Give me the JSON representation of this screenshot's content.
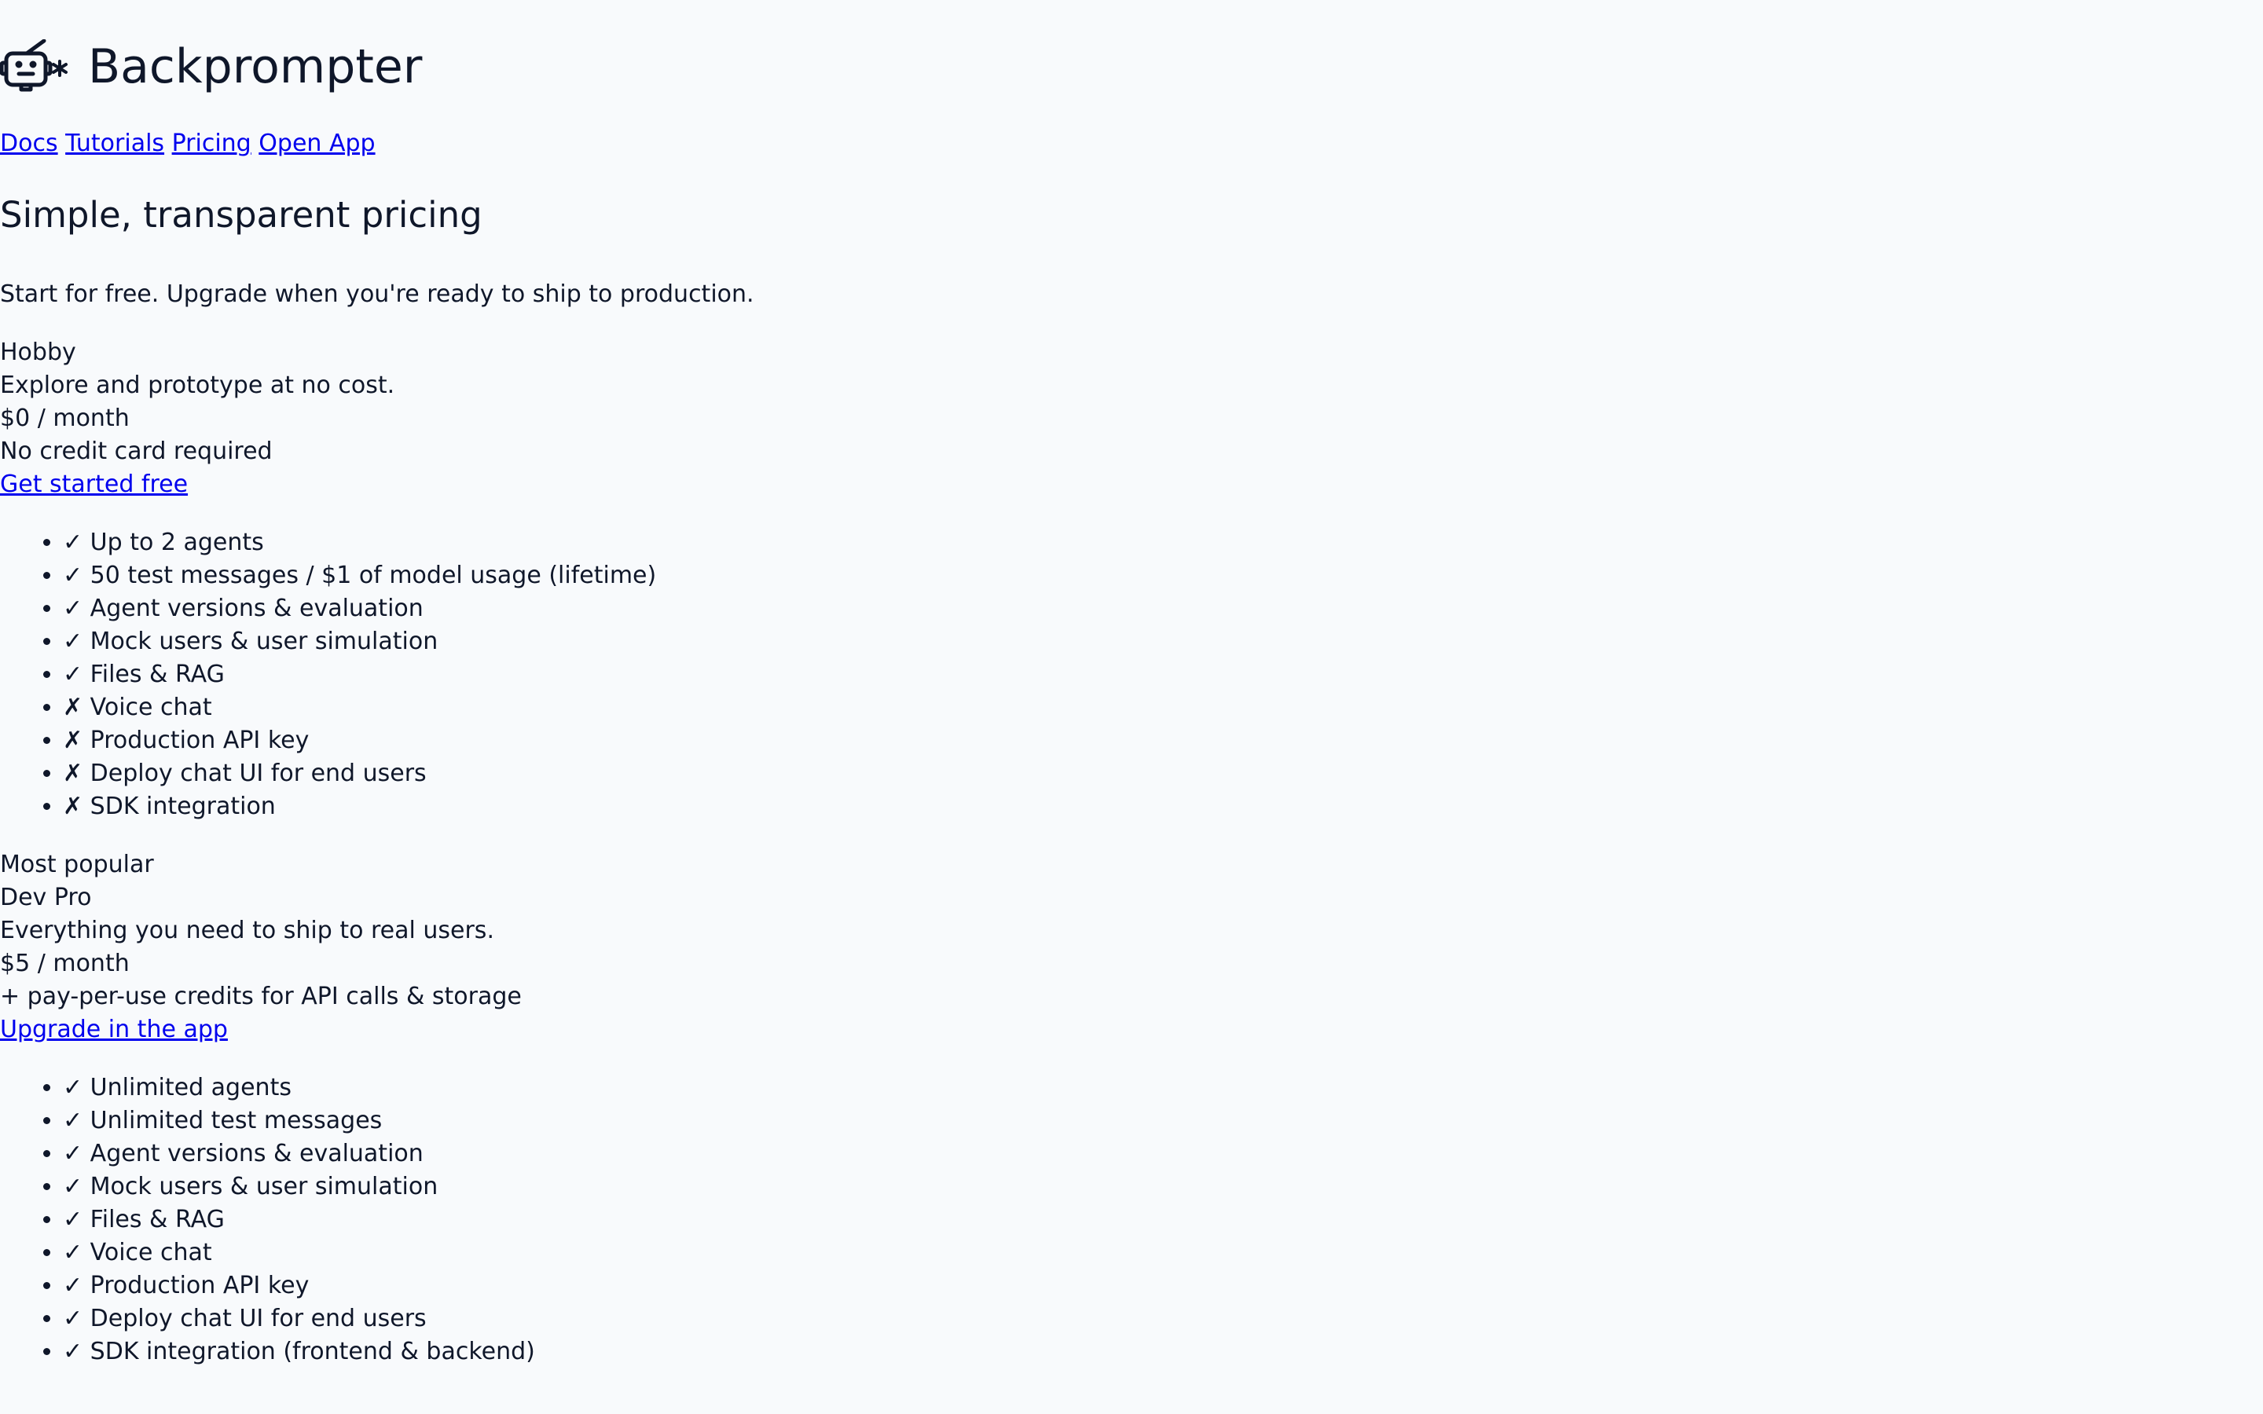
{
  "brand": {
    "name": "Backprompter"
  },
  "nav": {
    "items": [
      "Docs",
      "Tutorials",
      "Pricing",
      "Open App"
    ]
  },
  "hero": {
    "title": "Simple, transparent pricing",
    "subtitle": "Start for free. Upgrade when you're ready to ship to production."
  },
  "plans": [
    {
      "name": "Hobby",
      "description": "Explore and prototype at no cost.",
      "price": "$0 / month",
      "note": "No credit card required",
      "cta": "Get started free",
      "features": [
        "✓ Up to 2 agents",
        "✓ 50 test messages / $1 of model usage (lifetime)",
        "✓ Agent versions & evaluation",
        "✓ Mock users & user simulation",
        "✓ Files & RAG",
        "✗ Voice chat",
        "✗ Production API key",
        "✗ Deploy chat UI for end users",
        "✗ SDK integration"
      ]
    },
    {
      "badge": "Most popular",
      "name": "Dev Pro",
      "description": "Everything you need to ship to real users.",
      "price": "$5 / month",
      "note": "+ pay-per-use credits for API calls & storage",
      "cta": "Upgrade in the app",
      "features": [
        "✓ Unlimited agents",
        "✓ Unlimited test messages",
        "✓ Agent versions & evaluation",
        "✓ Mock users & user simulation",
        "✓ Files & RAG",
        "✓ Voice chat",
        "✓ Production API key",
        "✓ Deploy chat UI for end users",
        "✓ SDK integration (frontend & backend)"
      ]
    }
  ],
  "icons": {
    "logo": "robot-icon"
  },
  "colors": {
    "background": "#f8fafc",
    "text": "#0f172a",
    "link": "#0000ee"
  }
}
